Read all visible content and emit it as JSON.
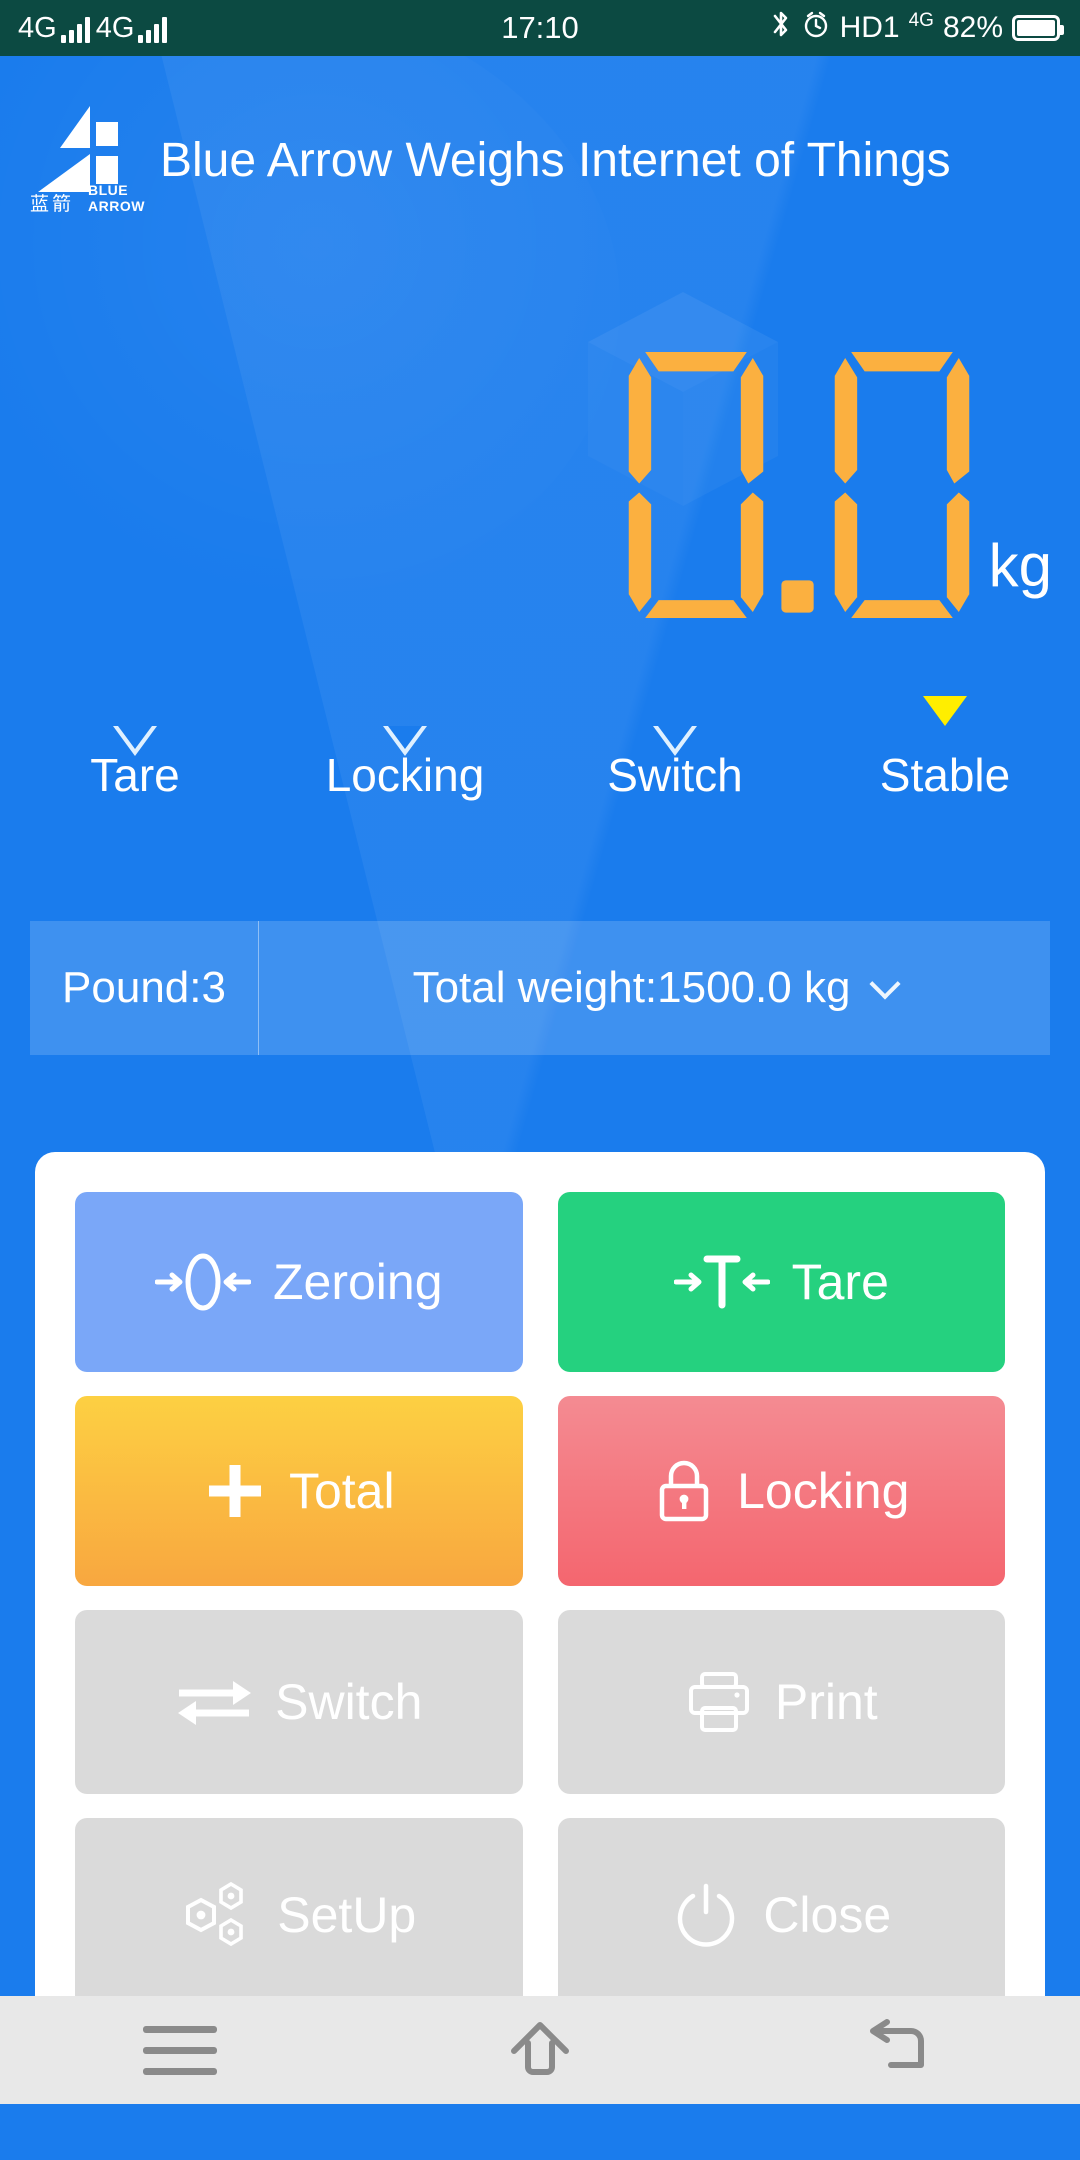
{
  "statusbar": {
    "network_1": "4G",
    "network_2": "4G",
    "time": "17:10",
    "volte": "HD1",
    "data_badge": "4G",
    "battery_percent": "82%"
  },
  "header": {
    "title": "Blue Arrow Weighs Internet of Things",
    "logo_cn": "蓝箭",
    "logo_en": "BLUE ARROW"
  },
  "weight": {
    "digit_1": "0",
    "separator": ".",
    "digit_2": "0",
    "value": "0.0",
    "unit": "kg",
    "digit_color": "#fbb040"
  },
  "indicators": [
    {
      "label": "Tare",
      "state": "off"
    },
    {
      "label": "Locking",
      "state": "off"
    },
    {
      "label": "Switch",
      "state": "off"
    },
    {
      "label": "Stable",
      "state": "on"
    }
  ],
  "indicator_active_color": "#ffee00",
  "infobar": {
    "pound": "Pound:3",
    "total_weight": "Total weight:1500.0 kg"
  },
  "buttons": [
    {
      "label": "Zeroing",
      "icon": "zeroing-arrows-icon",
      "state": "enabled",
      "color": "#7aa7f8"
    },
    {
      "label": "Tare",
      "icon": "tare-arrows-icon",
      "state": "enabled",
      "color": "#25d17f"
    },
    {
      "label": "Total",
      "icon": "plus-icon",
      "state": "enabled",
      "color": "#f9b840"
    },
    {
      "label": "Locking",
      "icon": "lock-icon",
      "state": "enabled",
      "color": "#f4666f"
    },
    {
      "label": "Switch",
      "icon": "swap-arrows-icon",
      "state": "disabled",
      "color": "#dadada"
    },
    {
      "label": "Print",
      "icon": "printer-icon",
      "state": "disabled",
      "color": "#dadada"
    },
    {
      "label": "SetUp",
      "icon": "hex-gears-icon",
      "state": "disabled",
      "color": "#dadada"
    },
    {
      "label": "Close",
      "icon": "power-icon",
      "state": "disabled",
      "color": "#dadada"
    }
  ],
  "navbar": {
    "menu": "menu-icon",
    "home": "home-icon",
    "back": "back-icon"
  },
  "theme": {
    "background": "#1a7ced",
    "statusbar_bg": "#0c4a42",
    "card_bg": "#ffffff"
  }
}
